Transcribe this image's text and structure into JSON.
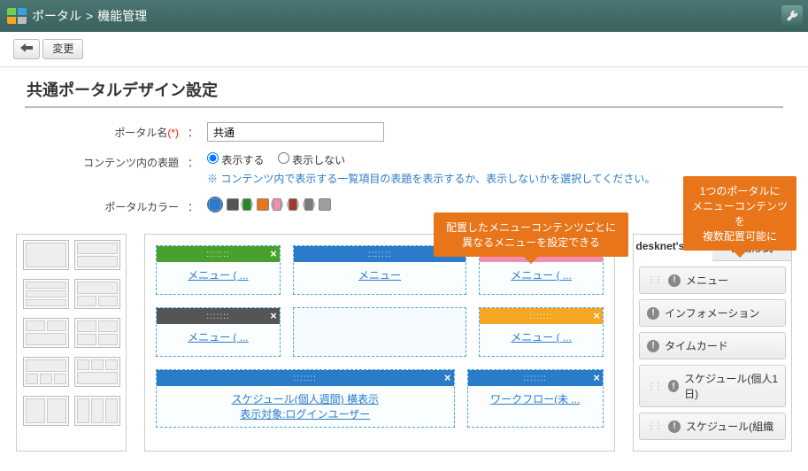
{
  "header": {
    "breadcrumb_root": "ポータル",
    "breadcrumb_sep": ">",
    "breadcrumb_page": "機能管理"
  },
  "toolbar": {
    "back": "←",
    "submit": "変更"
  },
  "title": "共通ポータルデザイン設定",
  "form": {
    "name_label": "ポータル名",
    "name_req": "(*)",
    "name_value": "共通",
    "titles_label": "コンテンツ内の表題",
    "radio_show": "表示する",
    "radio_hide": "表示しない",
    "titles_hint": "※ コンテンツ内で表示する一覧項目の表題を表示するか、表示しないかを選択してください。",
    "color_label": "ポータルカラー"
  },
  "colors": [
    "#2a7bc9",
    "#555555",
    "#1e8a2a",
    "#e8751a",
    "#f28db2",
    "#a2382e",
    "#7a7a7a",
    "#9e9e9e"
  ],
  "callouts": {
    "c1_l1": "配置したメニューコンテンツごとに",
    "c1_l2": "異なるメニューを設定できる",
    "c2_l1": "1つのポータルに",
    "c2_l2": "メニューコンテンツを",
    "c2_l3": "複数配置可能に"
  },
  "widgets": {
    "row1": [
      {
        "hdr": "#4aa02c",
        "title": "メニュー ( ..."
      },
      {
        "hdr": "#2a7bc9",
        "title": "メニュー"
      },
      {
        "hdr": "#f28db2",
        "title": "メニュー ( ..."
      }
    ],
    "row2a": {
      "hdr": "#555555",
      "title": "メニュー ( ..."
    },
    "row2c": {
      "hdr": "#f5a623",
      "title": "メニュー ( ..."
    },
    "row3a": {
      "hdr": "#2a7bc9",
      "title_l1": "スケジュール(個人週間) 横表示",
      "title_l2": "表示対象:ログインユーザー"
    },
    "row3b": {
      "hdr": "#2a7bc9",
      "title": "ワークフロー(未 ..."
    }
  },
  "side": {
    "tab1": "desknet's NEO",
    "tab2": "自由形式",
    "items": [
      "メニュー",
      "インフォメーション",
      "タイムカード",
      "スケジュール(個人1日)",
      "スケジュール(組織"
    ]
  },
  "chart_data": null
}
